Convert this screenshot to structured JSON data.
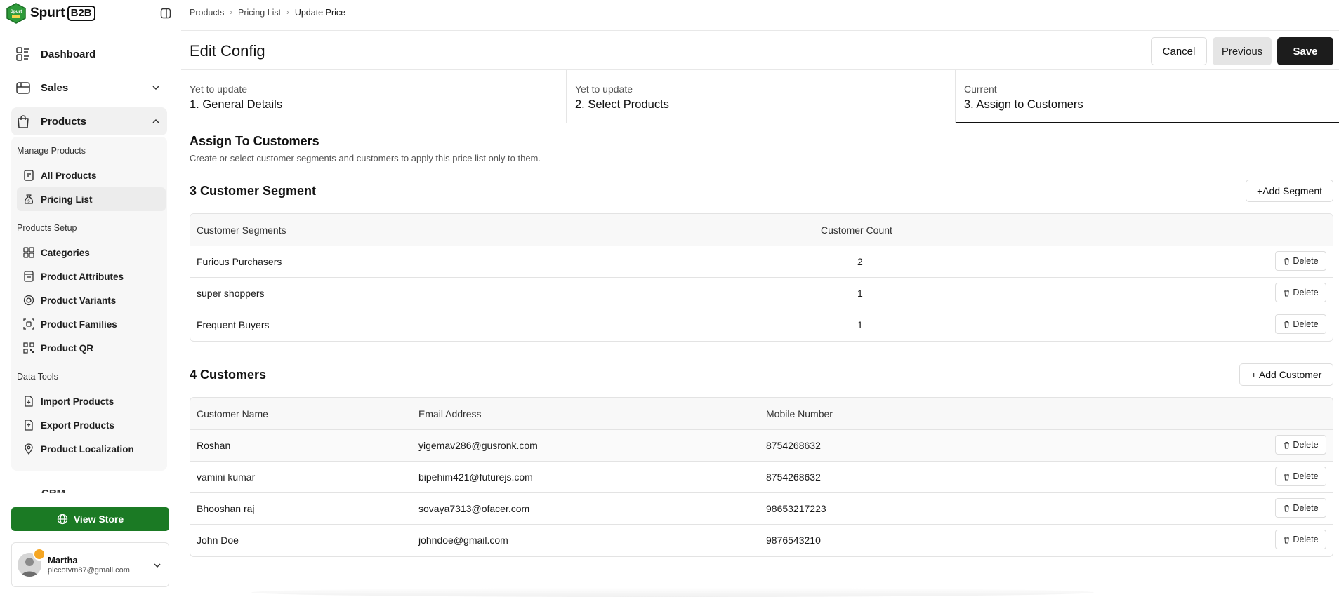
{
  "app": {
    "name": "Spurt",
    "badge": "B2B",
    "logo_mark": "Spurt"
  },
  "sidebar": {
    "top_items": [
      {
        "label": "Dashboard",
        "icon": "dashboard-icon"
      },
      {
        "label": "Sales",
        "icon": "sales-icon"
      },
      {
        "label": "Products",
        "icon": "shopping-bag-icon"
      }
    ],
    "groups": [
      {
        "label": "Manage Products",
        "items": [
          {
            "label": "All Products",
            "icon": "document-icon"
          },
          {
            "label": "Pricing List",
            "icon": "money-bag-icon",
            "active": true
          }
        ]
      },
      {
        "label": "Products Setup",
        "items": [
          {
            "label": "Categories",
            "icon": "categories-icon"
          },
          {
            "label": "Product Attributes",
            "icon": "attributes-icon"
          },
          {
            "label": "Product Variants",
            "icon": "variants-icon"
          },
          {
            "label": "Product Families",
            "icon": "families-icon"
          },
          {
            "label": "Product QR",
            "icon": "qr-icon"
          }
        ]
      },
      {
        "label": "Data Tools",
        "items": [
          {
            "label": "Import Products",
            "icon": "import-icon"
          },
          {
            "label": "Export Products",
            "icon": "export-icon"
          },
          {
            "label": "Product Localization",
            "icon": "location-pin-icon"
          }
        ]
      }
    ],
    "partial_item": "CRM",
    "view_store": "View Store",
    "user": {
      "name": "Martha",
      "email": "piccotvm87@gmail.com"
    }
  },
  "breadcrumb": [
    "Products",
    "Pricing List",
    "Update Price"
  ],
  "page": {
    "title": "Edit Config"
  },
  "actions": {
    "cancel": "Cancel",
    "previous": "Previous",
    "save": "Save"
  },
  "steps": [
    {
      "status": "Yet to update",
      "title": "1. General Details"
    },
    {
      "status": "Yet to update",
      "title": "2. Select Products"
    },
    {
      "status": "Current",
      "title": "3. Assign to Customers"
    }
  ],
  "assign": {
    "heading": "Assign To Customers",
    "description": "Create or select customer segments and customers to apply this price list only to them."
  },
  "segments": {
    "heading": "3 Customer Segment",
    "add_label": "+Add Segment",
    "columns": [
      "Customer Segments",
      "Customer Count"
    ],
    "rows": [
      {
        "name": "Furious Purchasers",
        "count": "2"
      },
      {
        "name": "super shoppers",
        "count": "1"
      },
      {
        "name": "Frequent Buyers",
        "count": "1"
      }
    ]
  },
  "customers": {
    "heading": "4 Customers",
    "add_label": "+ Add Customer",
    "columns": [
      "Customer Name",
      "Email Address",
      "Mobile Number"
    ],
    "rows": [
      {
        "name": "Roshan",
        "email": "yigemav286@gusronk.com",
        "mobile": "8754268632"
      },
      {
        "name": "vamini kumar",
        "email": "bipehim421@futurejs.com",
        "mobile": "8754268632"
      },
      {
        "name": "Bhooshan raj",
        "email": "sovaya7313@ofacer.com",
        "mobile": "98653217223"
      },
      {
        "name": "John Doe",
        "email": "johndoe@gmail.com",
        "mobile": "9876543210"
      }
    ]
  },
  "delete_label": "Delete",
  "colors": {
    "brand_green": "#1b7a24",
    "dark_button": "#1c1c1c",
    "badge_orange": "#f5a623"
  }
}
